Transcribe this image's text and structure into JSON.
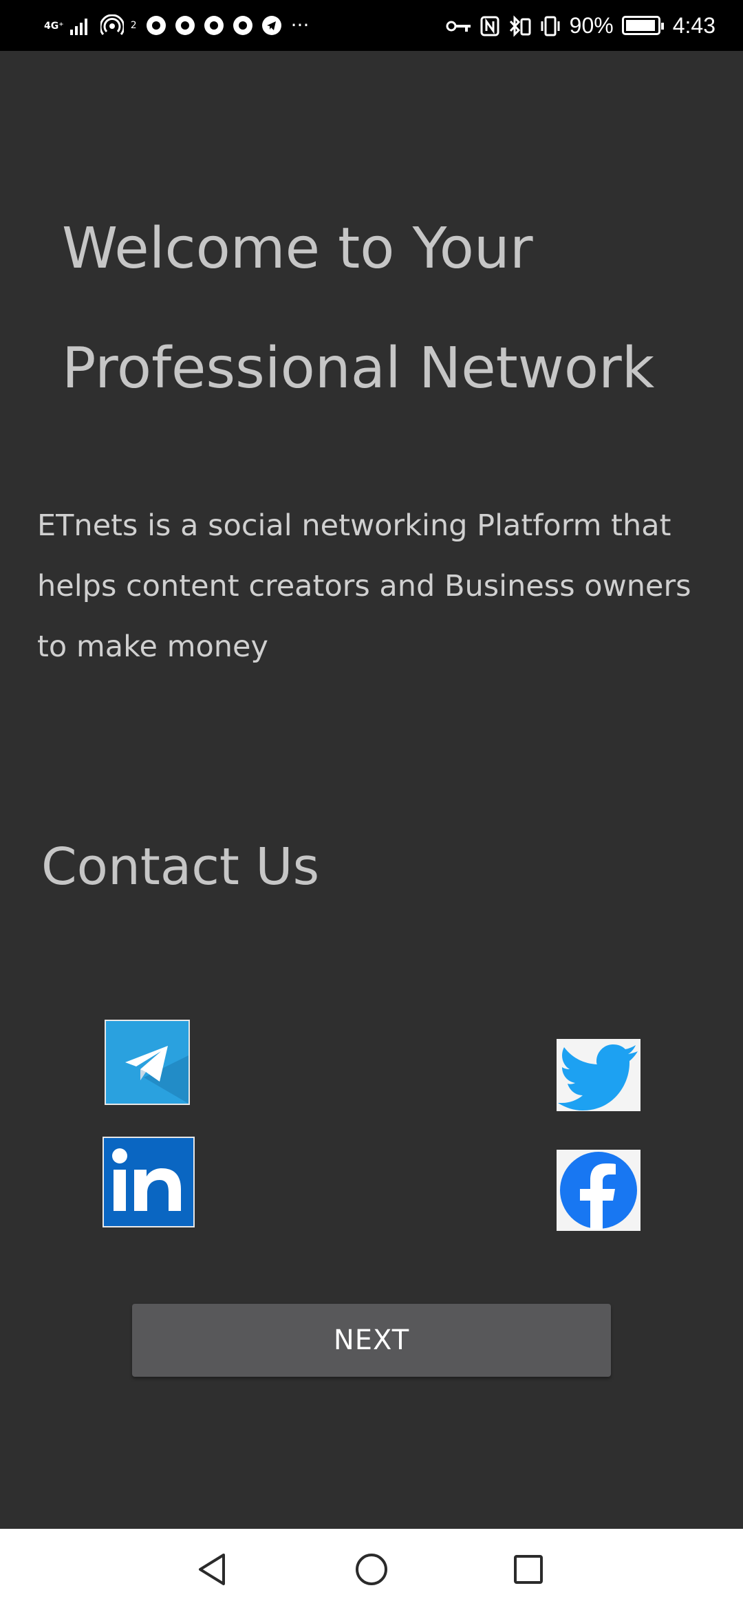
{
  "status_bar": {
    "network": "4G⁺",
    "hotspot_count": "2",
    "more": "···",
    "battery": "90%",
    "time": "4:43",
    "icons": [
      "signal-icon",
      "hotspot-icon",
      "chrome-icon",
      "chrome-icon",
      "chrome-icon",
      "chrome-icon",
      "telegram-icon",
      "key-icon",
      "nfc-icon",
      "bluetooth-icon",
      "vibrate-icon",
      "battery-icon"
    ]
  },
  "main": {
    "title_line1": "Welcome to Your",
    "title_line2": "Professional Network",
    "description": "ETnets is a social networking Platform that helps content creators and Business owners to make money",
    "contact_title": "Contact Us",
    "next_label": "NEXT"
  },
  "social": [
    {
      "name": "telegram",
      "icon": "telegram-icon",
      "color": "#2aa1df"
    },
    {
      "name": "twitter",
      "icon": "twitter-icon",
      "color": "#1da1f2"
    },
    {
      "name": "linkedin",
      "icon": "linkedin-icon",
      "color": "#0a66c2"
    },
    {
      "name": "facebook",
      "icon": "facebook-icon",
      "color": "#1877f2"
    }
  ],
  "nav": {
    "icons": [
      "back-icon",
      "home-icon",
      "recents-icon"
    ]
  },
  "colors": {
    "background": "#2f2f2f",
    "text": "#c6c6c6",
    "button": "#58585a",
    "status_bar": "#000000",
    "nav_bar": "#ffffff"
  }
}
